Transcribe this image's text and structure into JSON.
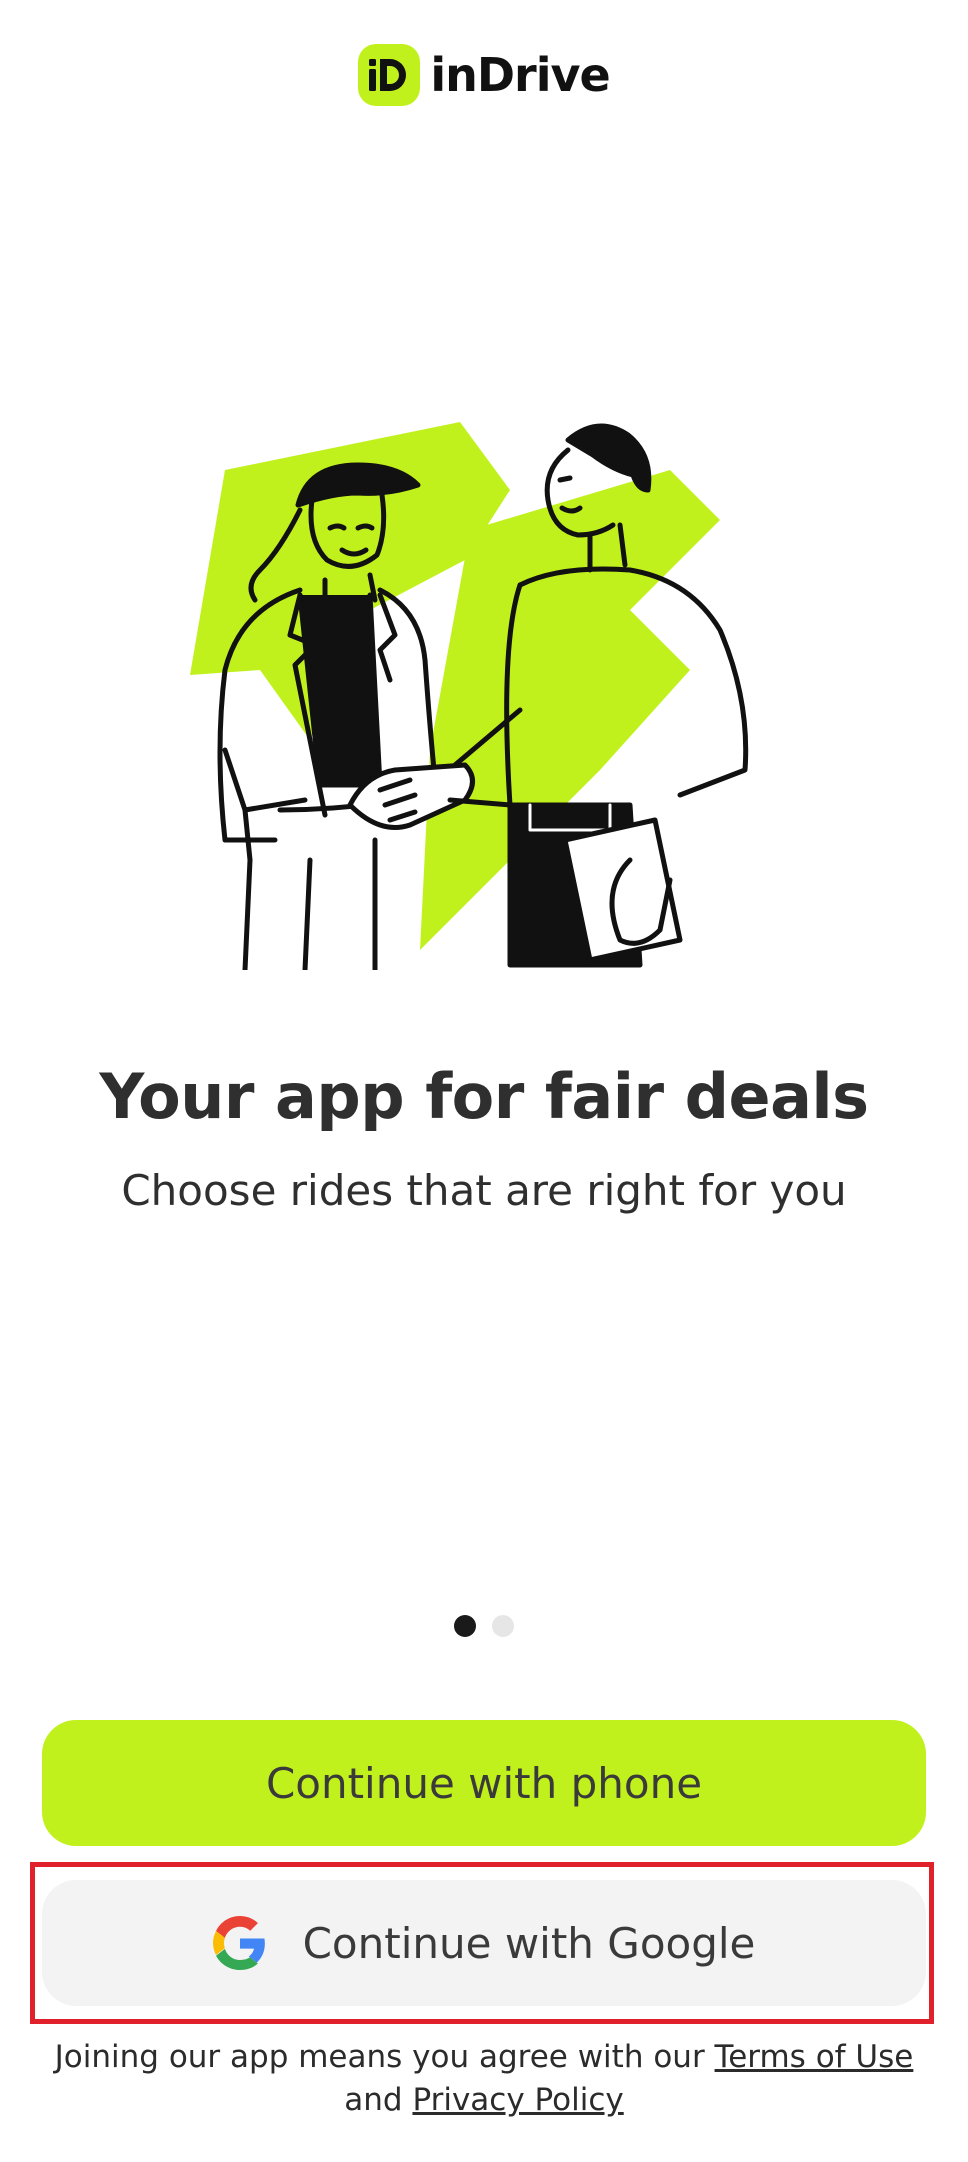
{
  "header": {
    "logo_text": "inDrive",
    "logo_badge_text": "iD"
  },
  "illustration": {
    "name": "handshake-illustration",
    "accent_color": "#c1f11d"
  },
  "onboarding": {
    "title": "Your app for fair deals",
    "subtitle": "Choose rides that are right for you",
    "pager": {
      "total": 2,
      "active_index": 0
    }
  },
  "actions": {
    "phone_label": "Continue with phone",
    "google_label": "Continue with Google",
    "google_icon": "google-g-icon"
  },
  "legal": {
    "prefix": "Joining our app means you agree with our ",
    "terms_label": "Terms of Use",
    "middle": "and ",
    "privacy_label": "Privacy Policy"
  },
  "colors": {
    "brand": "#c1f11d",
    "secondary_button": "#f3f3f3",
    "highlight": "#e0202a",
    "text": "#2f2f2f"
  }
}
